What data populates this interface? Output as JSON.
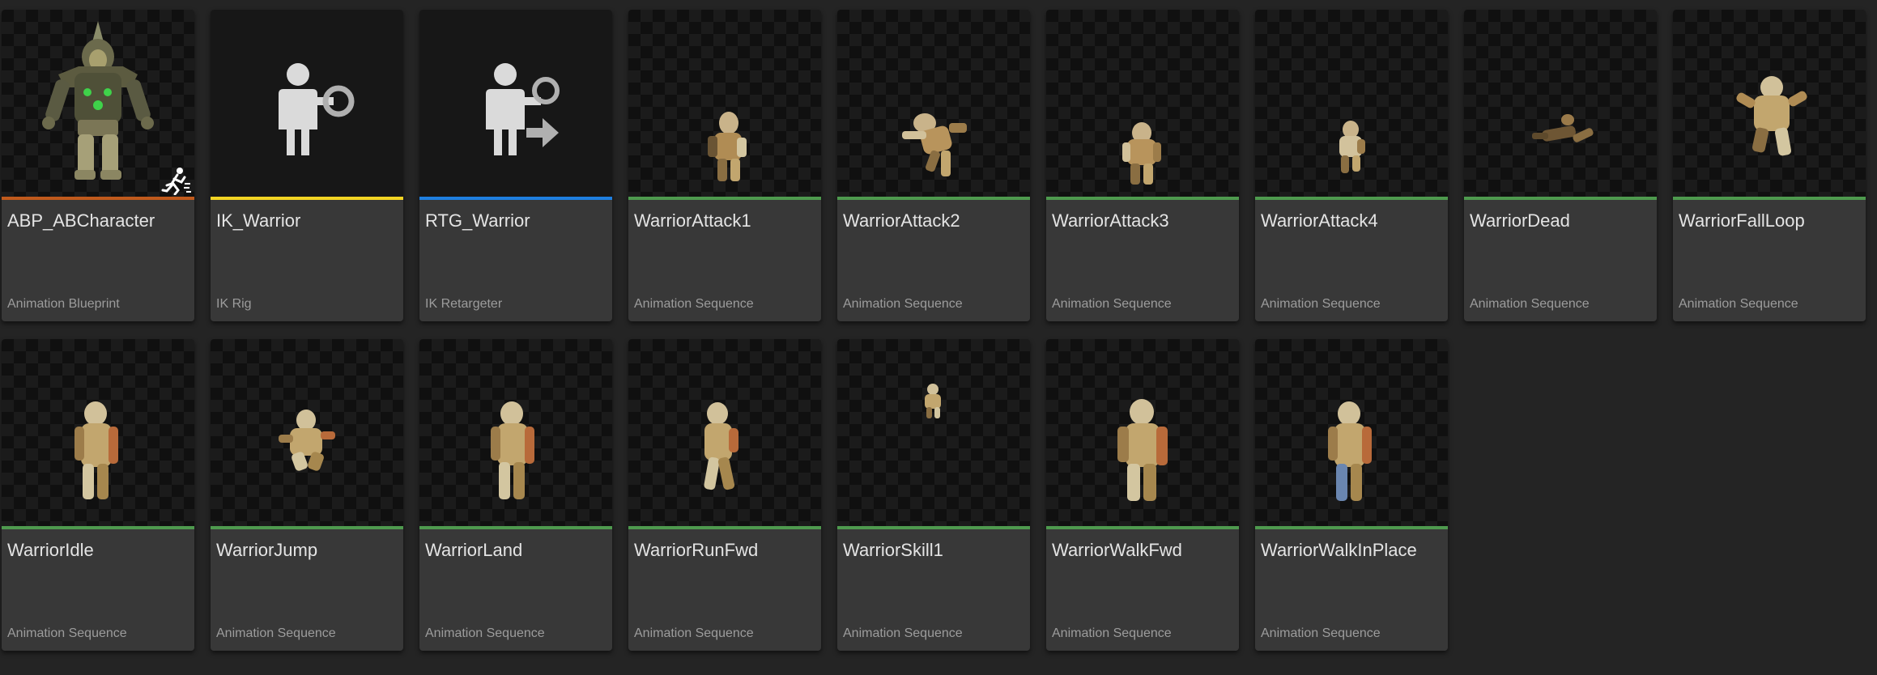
{
  "colors": {
    "blueprint": "#c05a1c",
    "ikrig": "#f2d423",
    "retargeter": "#1f7fe0",
    "sequence": "#4e9a4e"
  },
  "assets": [
    {
      "name": "ABP_ABCharacter",
      "type": "Animation Blueprint",
      "icon": "animation-blueprint-thumbnail"
    },
    {
      "name": "IK_Warrior",
      "type": "IK Rig",
      "icon": "ik-rig-icon"
    },
    {
      "name": "RTG_Warrior",
      "type": "IK Retargeter",
      "icon": "ik-retargeter-icon"
    },
    {
      "name": "WarriorAttack1",
      "type": "Animation Sequence",
      "icon": "warrior-thumbnail"
    },
    {
      "name": "WarriorAttack2",
      "type": "Animation Sequence",
      "icon": "warrior-thumbnail"
    },
    {
      "name": "WarriorAttack3",
      "type": "Animation Sequence",
      "icon": "warrior-thumbnail"
    },
    {
      "name": "WarriorAttack4",
      "type": "Animation Sequence",
      "icon": "warrior-thumbnail"
    },
    {
      "name": "WarriorDead",
      "type": "Animation Sequence",
      "icon": "warrior-thumbnail"
    },
    {
      "name": "WarriorFallLoop",
      "type": "Animation Sequence",
      "icon": "warrior-thumbnail"
    },
    {
      "name": "WarriorIdle",
      "type": "Animation Sequence",
      "icon": "warrior-thumbnail"
    },
    {
      "name": "WarriorJump",
      "type": "Animation Sequence",
      "icon": "warrior-thumbnail"
    },
    {
      "name": "WarriorLand",
      "type": "Animation Sequence",
      "icon": "warrior-thumbnail"
    },
    {
      "name": "WarriorRunFwd",
      "type": "Animation Sequence",
      "icon": "warrior-thumbnail"
    },
    {
      "name": "WarriorSkill1",
      "type": "Animation Sequence",
      "icon": "warrior-thumbnail"
    },
    {
      "name": "WarriorWalkFwd",
      "type": "Animation Sequence",
      "icon": "warrior-thumbnail"
    },
    {
      "name": "WarriorWalkInPlace",
      "type": "Animation Sequence",
      "icon": "warrior-thumbnail"
    }
  ]
}
